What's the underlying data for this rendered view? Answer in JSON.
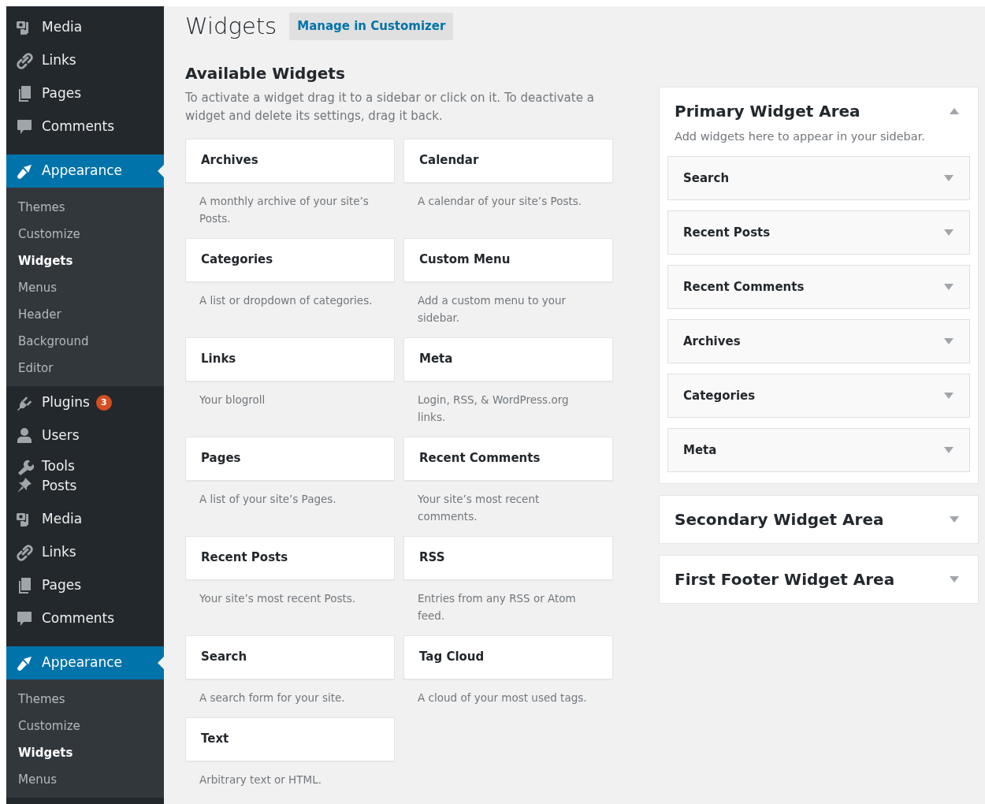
{
  "sidebar": {
    "items": [
      {
        "kind": "media",
        "label": "Media",
        "selected": false
      },
      {
        "kind": "links",
        "label": "Links",
        "selected": false
      },
      {
        "kind": "pages",
        "label": "Pages",
        "selected": false
      },
      {
        "kind": "comments",
        "label": "Comments",
        "selected": false
      },
      {
        "kind": "appearance",
        "label": "Appearance",
        "selected": true
      },
      {
        "kind": "submenu",
        "children": [
          {
            "label": "Themes",
            "selected": false
          },
          {
            "label": "Customize",
            "selected": false
          },
          {
            "label": "Widgets",
            "selected": true
          },
          {
            "label": "Menus",
            "selected": false
          },
          {
            "label": "Header",
            "selected": false
          },
          {
            "label": "Background",
            "selected": false
          },
          {
            "label": "Editor",
            "selected": false
          }
        ]
      },
      {
        "kind": "plugins",
        "label": "Plugins",
        "badge": "3",
        "selected": false
      },
      {
        "kind": "users",
        "label": "Users",
        "selected": false
      },
      {
        "kind": "tools",
        "label": "Tools",
        "selected": false
      },
      {
        "kind": "posts",
        "label": "Posts",
        "selected": false
      },
      {
        "kind": "media",
        "label": "Media",
        "selected": false
      },
      {
        "kind": "links",
        "label": "Links",
        "selected": false
      },
      {
        "kind": "pages",
        "label": "Pages",
        "selected": false
      },
      {
        "kind": "comments",
        "label": "Comments",
        "selected": false
      },
      {
        "kind": "appearance",
        "label": "Appearance",
        "selected": true
      },
      {
        "kind": "submenu",
        "children": [
          {
            "label": "Themes",
            "selected": false
          },
          {
            "label": "Customize",
            "selected": false
          },
          {
            "label": "Widgets",
            "selected": true
          },
          {
            "label": "Menus",
            "selected": false
          }
        ]
      }
    ]
  },
  "page": {
    "title": "Widgets",
    "action": "Manage in Customizer"
  },
  "available": {
    "heading": "Available Widgets",
    "description": "To activate a widget drag it to a sidebar or click on it. To deactivate a widget and delete its settings, drag it back.",
    "widgets": [
      {
        "title": "Archives",
        "description": "A monthly archive of your site’s Posts."
      },
      {
        "title": "Calendar",
        "description": "A calendar of your site’s Posts."
      },
      {
        "title": "Categories",
        "description": "A list or dropdown of categories."
      },
      {
        "title": "Custom Menu",
        "description": "Add a custom menu to your sidebar."
      },
      {
        "title": "Links",
        "description": "Your blogroll"
      },
      {
        "title": "Meta",
        "description": "Login, RSS, & WordPress.org links."
      },
      {
        "title": "Pages",
        "description": "A list of your site’s Pages."
      },
      {
        "title": "Recent Comments",
        "description": "Your site’s most recent comments."
      },
      {
        "title": "Recent Posts",
        "description": "Your site’s most recent Posts."
      },
      {
        "title": "RSS",
        "description": "Entries from any RSS or Atom feed."
      },
      {
        "title": "Search",
        "description": "A search form for your site."
      },
      {
        "title": "Tag Cloud",
        "description": "A cloud of your most used tags."
      },
      {
        "title": "Text",
        "description": "Arbitrary text or HTML."
      }
    ]
  },
  "areas": [
    {
      "title": "Primary Widget Area",
      "description": "Add widgets here to appear in your sidebar.",
      "expanded": true,
      "widgets": [
        {
          "title": "Search",
          "expanded": false
        },
        {
          "title": "Recent Posts",
          "expanded": false
        },
        {
          "title": "Recent Comments",
          "expanded": false
        },
        {
          "title": "Archives",
          "expanded": false
        },
        {
          "title": "Categories",
          "expanded": false
        },
        {
          "title": "Meta",
          "expanded": false
        }
      ]
    },
    {
      "title": "Secondary Widget Area",
      "expanded": false
    },
    {
      "title": "First Footer Widget Area",
      "expanded": false
    }
  ]
}
